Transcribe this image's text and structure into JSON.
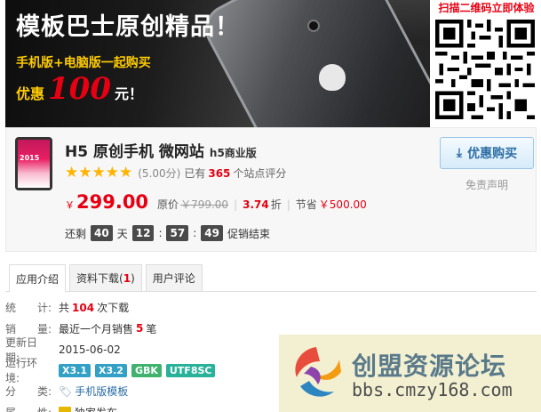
{
  "banner": {
    "title": "模板巴士原创精品！",
    "subtitle": "手机版+电脑版一起购买",
    "promo_prefix": "优惠",
    "promo_amount": "100",
    "promo_suffix": "元！"
  },
  "qr": {
    "caption": "扫描二维码立即体验"
  },
  "product": {
    "title": "H5 原创手机 微网站",
    "tag": "h5商业版",
    "rating": 5,
    "score_text": "(5.00分)",
    "reviews_prefix": "已有",
    "reviews_count": "365",
    "reviews_suffix": "个站点评分",
    "currency": "￥",
    "price": "299.00",
    "orig_label": "原价",
    "orig_price": "￥799.00",
    "discount": "3.74",
    "discount_unit": "折",
    "save_label": "节省",
    "save_amount": "￥500.00",
    "countdown_prefix": "还剩",
    "countdown_days": "40",
    "countdown_day_unit": "天",
    "countdown_h": "12",
    "countdown_m": "57",
    "countdown_s": "49",
    "countdown_suffix": "促销结束",
    "buy_label": "优惠购买",
    "disclaimer": "免责声明"
  },
  "tabs": [
    {
      "label": "应用介绍"
    },
    {
      "label": "资料下载(",
      "count": "1",
      "close": ")"
    },
    {
      "label": "用户评论"
    }
  ],
  "info": {
    "downloads_k1": "统",
    "downloads_k2": "计:",
    "downloads_prefix": "共",
    "downloads_count": "104",
    "downloads_suffix": "次下载",
    "sales_k1": "销",
    "sales_k2": "量:",
    "sales_prefix": "最近一个月销售",
    "sales_count": "5",
    "sales_suffix": "笔",
    "updated_k": "更新日期:",
    "updated_v": "2015-06-02",
    "env_k": "运行环境:",
    "env_badges": [
      "X3.1",
      "X3.2",
      "GBK",
      "UTF8SC"
    ],
    "cat_k1": "分",
    "cat_k2": "类:",
    "cat_v": "手机版模板",
    "attr_k1": "属",
    "attr_k2": "性:",
    "attr_v": "独家发布"
  },
  "watermark": {
    "name": "创盟资源论坛",
    "url": "bbs.cmzy168.com"
  }
}
